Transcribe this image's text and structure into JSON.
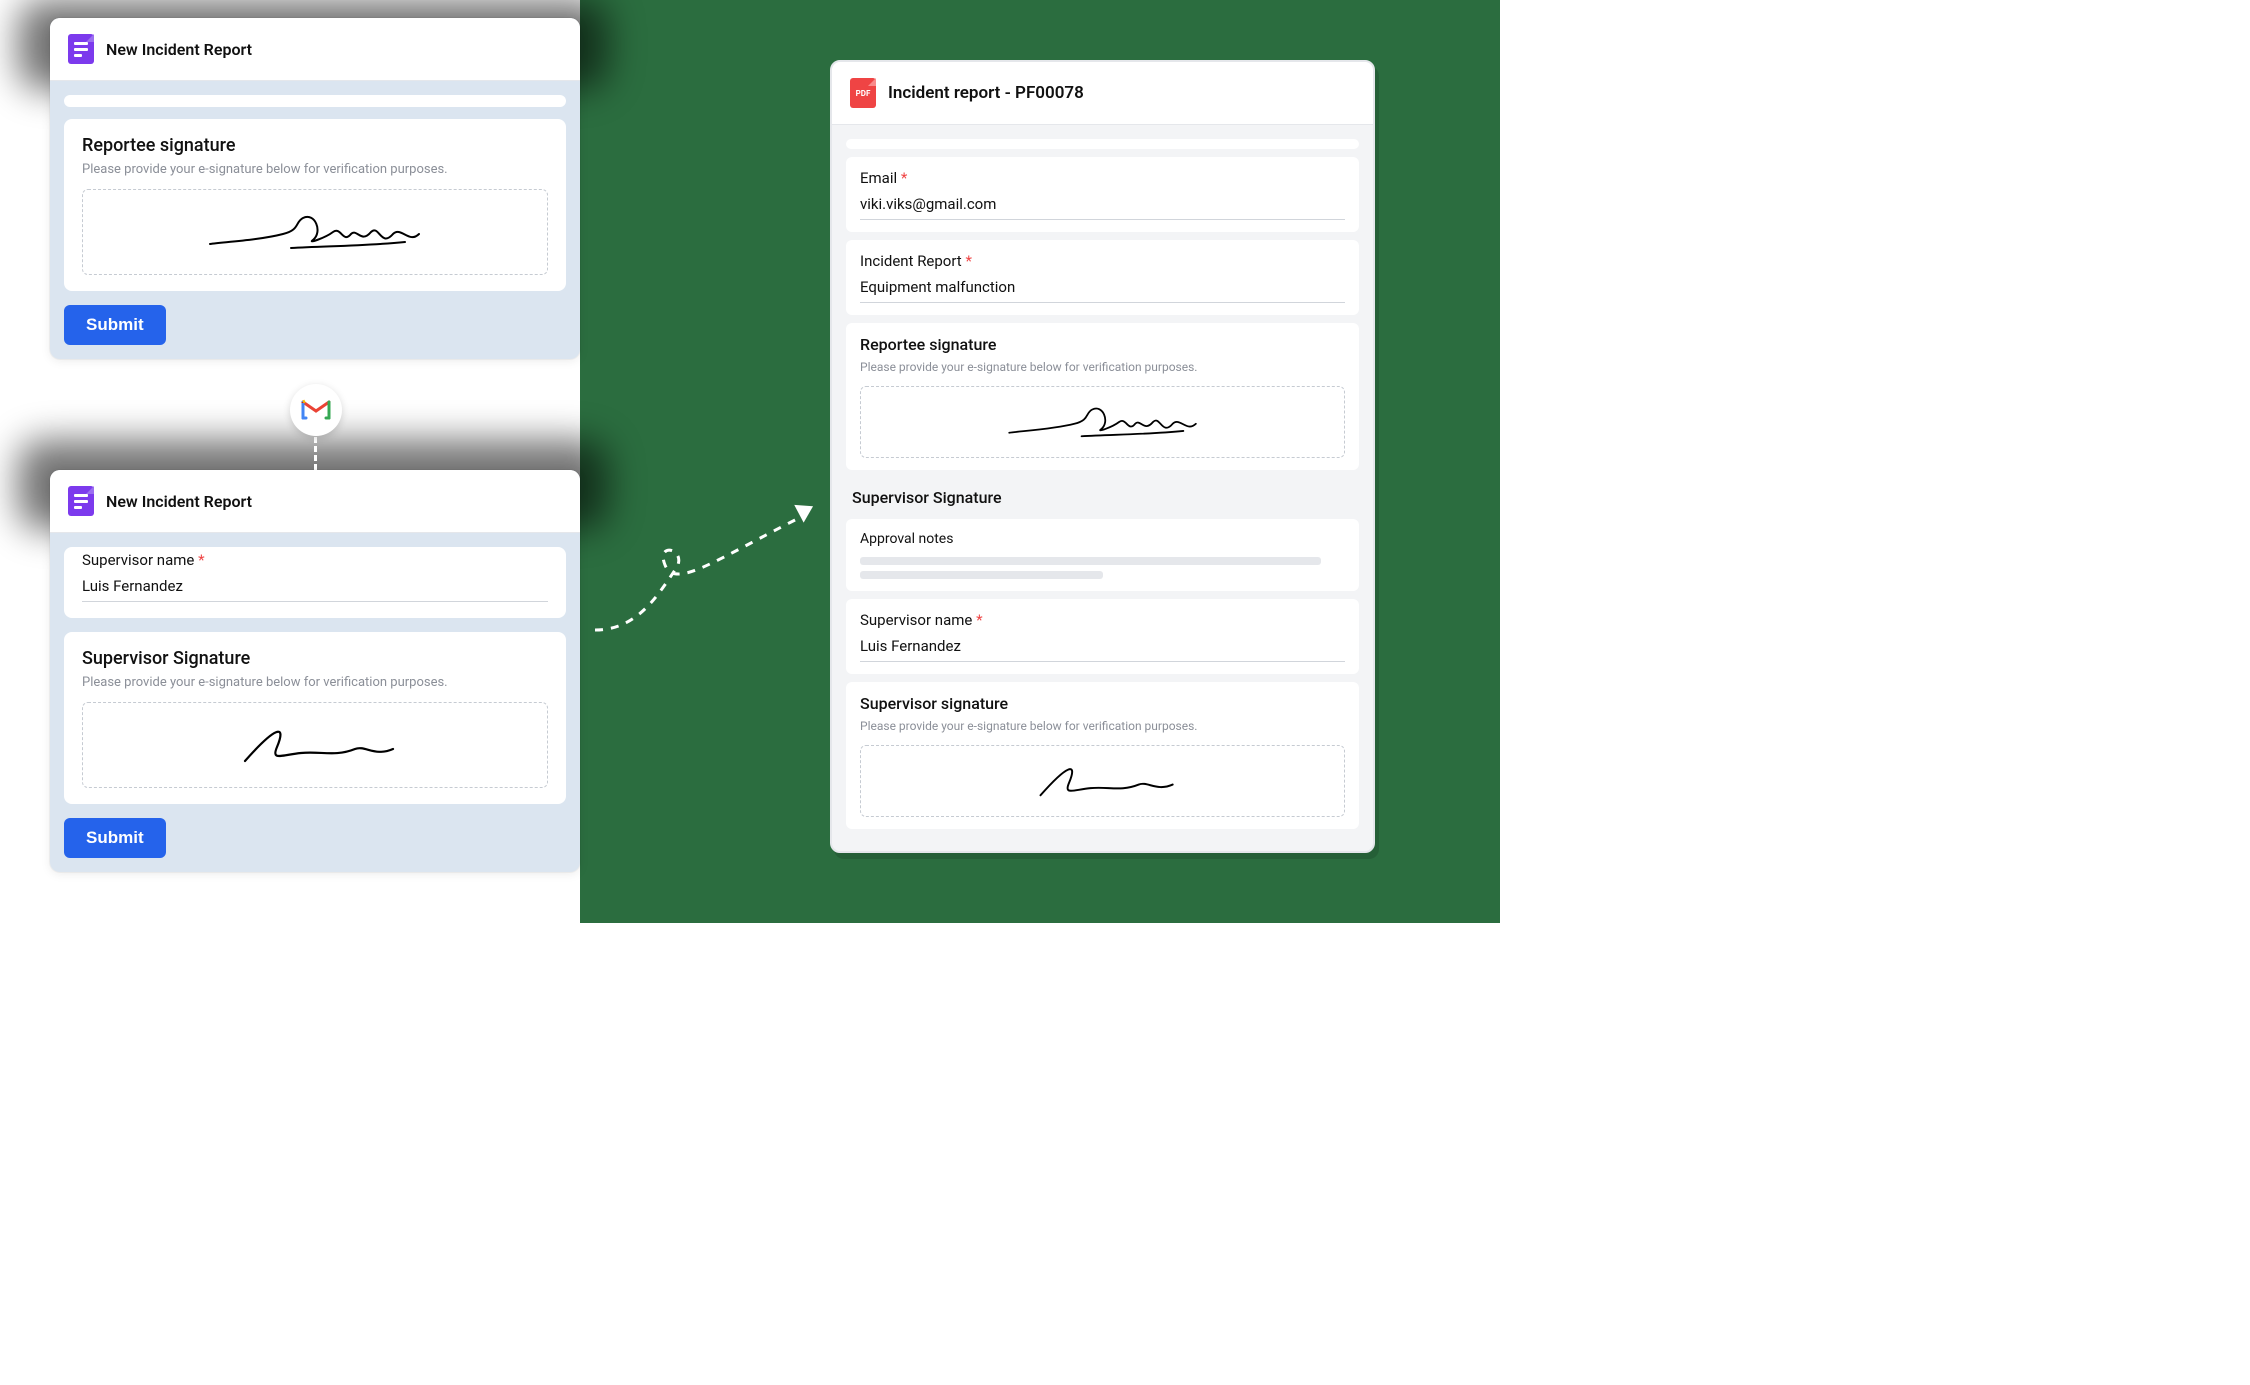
{
  "green_background": true,
  "card1": {
    "title": "New Incident Report",
    "section_title": "Reportee signature",
    "section_sub": "Please provide your e-signature below for verification purposes.",
    "submit": "Submit"
  },
  "card2": {
    "title": "New Incident Report",
    "name_label": "Supervisor name",
    "name_value": "Luis Fernandez",
    "section_title": "Supervisor Signature",
    "section_sub": "Please provide your e-signature below for verification purposes.",
    "submit": "Submit"
  },
  "gmail_icon": "gmail",
  "pdf": {
    "title": "Incident report - PF00078",
    "pdf_badge": "PDF",
    "email_label": "Email",
    "email_value": "viki.viks@gmail.com",
    "incident_label": "Incident Report",
    "incident_value": "Equipment malfunction",
    "reportee_sig_title": "Reportee signature",
    "reportee_sig_sub": "Please provide your e-signature below for verification purposes.",
    "supervisor_sig_heading": "Supervisor Signature",
    "approval_notes_label": "Approval notes",
    "supervisor_name_label": "Supervisor name",
    "supervisor_name_value": "Luis Fernandez",
    "supervisor_sig_title": "Supervisor signature",
    "supervisor_sig_sub": "Please provide your e-signature below for verification purposes."
  }
}
